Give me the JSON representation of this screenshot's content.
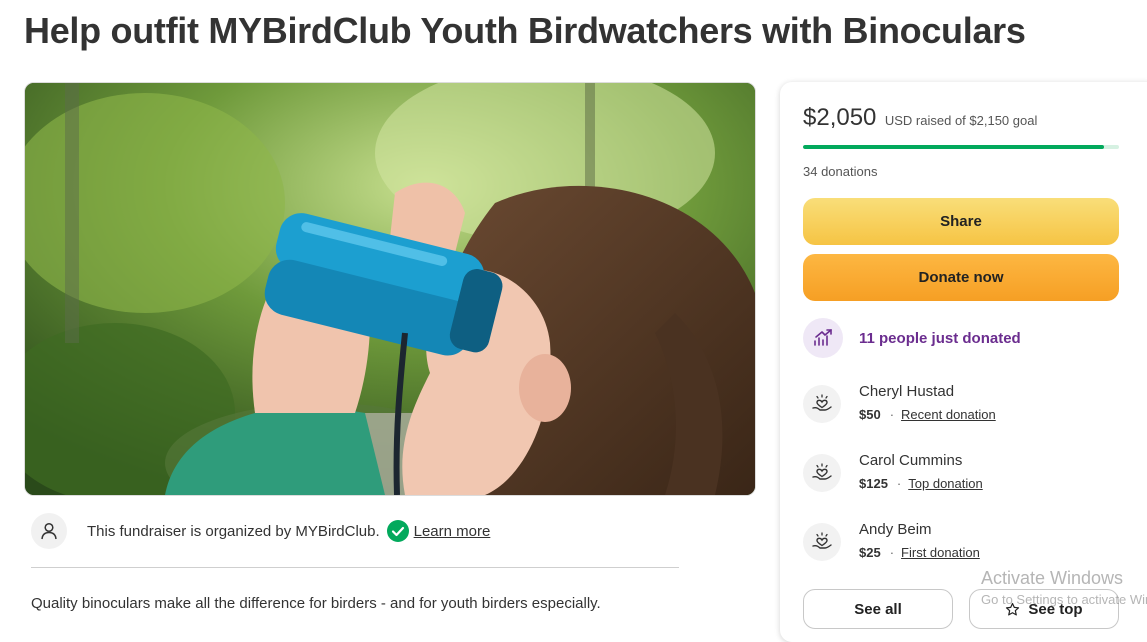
{
  "page": {
    "title": "Help outfit MYBirdClub Youth Birdwatchers with Binoculars"
  },
  "hero_image": {
    "alt": "",
    "subject": "child-with-binoculars-photo"
  },
  "organizer": {
    "text": "This fundraiser is organized by MYBirdClub.",
    "learn_more": "Learn more"
  },
  "description": "Quality binoculars make all the difference for birders - and for youth birders especially.",
  "donation_card": {
    "raised_amount": "$2,050",
    "raised_label": "USD raised of $2,150 goal",
    "progress_fraction": 0.9535,
    "donation_count": "34 donations",
    "share_label": "Share",
    "donate_label": "Donate now",
    "recent_activity": "11 people just donated",
    "donors": [
      {
        "name": "Cheryl Hustad",
        "amount": "$50",
        "tag": "Recent donation"
      },
      {
        "name": "Carol Cummins",
        "amount": "$125",
        "tag": "Top donation"
      },
      {
        "name": "Andy Beim",
        "amount": "$25",
        "tag": "First donation"
      }
    ],
    "see_all_label": "See all",
    "see_top_label": "See top"
  },
  "os_watermark": {
    "title": "Activate Windows",
    "subtitle": "Go to Settings to activate Windows."
  },
  "colors": {
    "accent_green": "#02a95c",
    "share_yellow": "#f6c444",
    "donate_orange": "#f69f24",
    "recent_purple": "#6b2d8f"
  },
  "icons": {
    "organizer_avatar": "user-icon",
    "verified": "verified-check-icon",
    "recent_activity": "trending-up-icon",
    "donor": "heart-hand-icon",
    "see_top": "star-icon"
  }
}
